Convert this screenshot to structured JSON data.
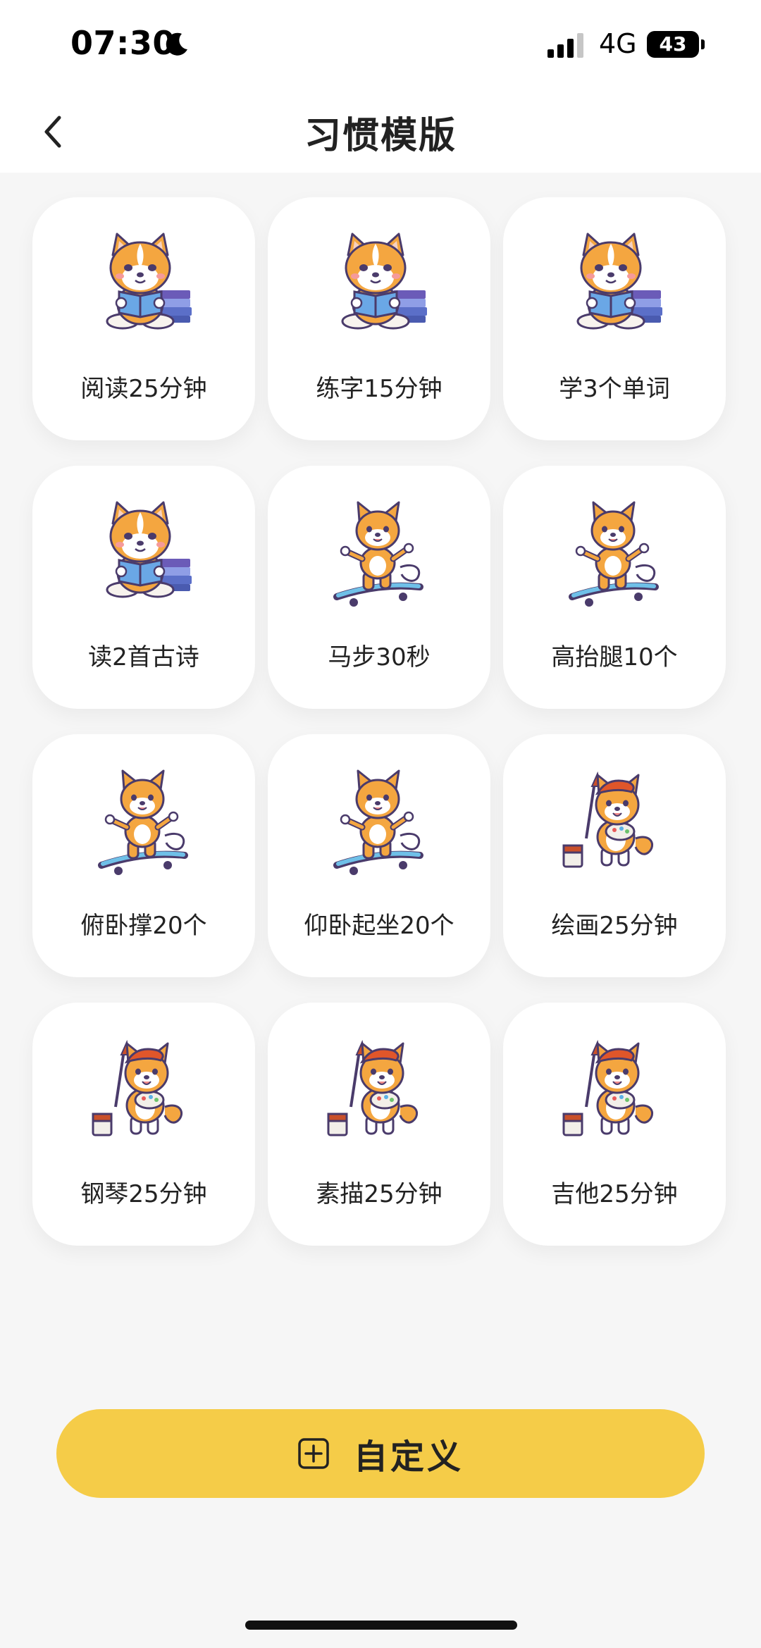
{
  "status_bar": {
    "time": "07:30",
    "network": "4G",
    "battery": "43"
  },
  "nav": {
    "title": "习惯模版"
  },
  "templates": [
    {
      "label": "阅读25分钟",
      "icon": "dog-reading-icon"
    },
    {
      "label": "练字15分钟",
      "icon": "dog-reading-icon"
    },
    {
      "label": "学3个单词",
      "icon": "dog-reading-icon"
    },
    {
      "label": "读2首古诗",
      "icon": "dog-reading-icon"
    },
    {
      "label": "马步30秒",
      "icon": "dog-skateboard-icon"
    },
    {
      "label": "高抬腿10个",
      "icon": "dog-skateboard-icon"
    },
    {
      "label": "俯卧撑20个",
      "icon": "dog-skateboard-icon"
    },
    {
      "label": "仰卧起坐20个",
      "icon": "dog-skateboard-icon"
    },
    {
      "label": "绘画25分钟",
      "icon": "dog-painter-icon"
    },
    {
      "label": "钢琴25分钟",
      "icon": "dog-painter-icon"
    },
    {
      "label": "素描25分钟",
      "icon": "dog-painter-icon"
    },
    {
      "label": "吉他25分钟",
      "icon": "dog-painter-icon"
    }
  ],
  "custom_button": {
    "label": "自定义"
  },
  "colors": {
    "accent": "#f5cc48",
    "background": "#f6f6f6",
    "card": "#ffffff"
  }
}
